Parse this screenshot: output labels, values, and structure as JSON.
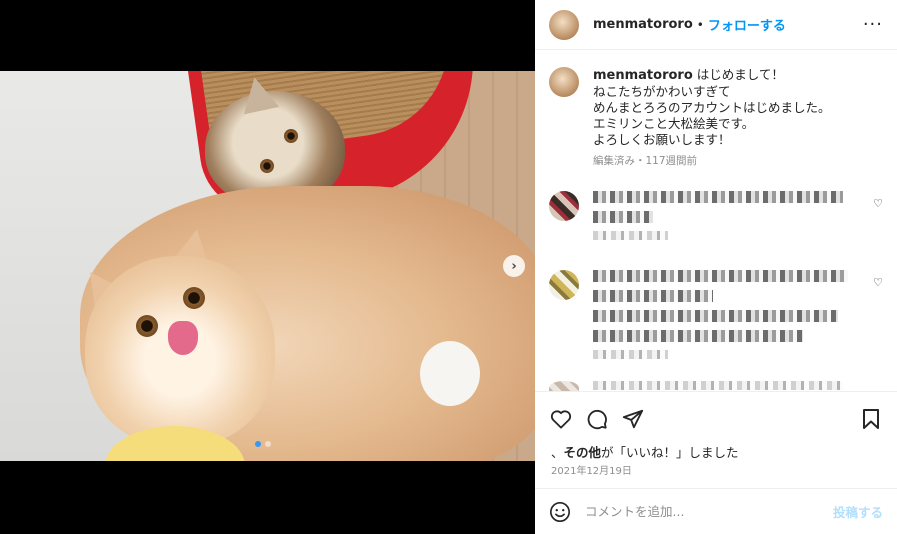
{
  "post": {
    "username": "menmatororo",
    "separator": "•",
    "follow_label": "フォローする",
    "more_icon": "more-horizontal-icon",
    "caption_lines": [
      "はじめまして！",
      "ねこたちがかわいすぎて",
      "めんまとろろのアカウントはじめました。",
      "エミリンこと大松絵美です。",
      "よろしくお願いします！"
    ],
    "caption_meta": "編集済み・117週間前",
    "likes_prefix": "、",
    "likes_bold": "その他",
    "likes_suffix": "が「いいね！」しました",
    "date": "2021年12月19日"
  },
  "media": {
    "carousel_count": 2,
    "carousel_active": 1,
    "next_icon": "chevron-right-icon"
  },
  "comment_box": {
    "placeholder": "コメントを追加...",
    "post_label": "投稿する"
  },
  "colors": {
    "accent": "#0095f6",
    "post_disabled": "#b2dffc",
    "meta": "#8e8e8e"
  }
}
